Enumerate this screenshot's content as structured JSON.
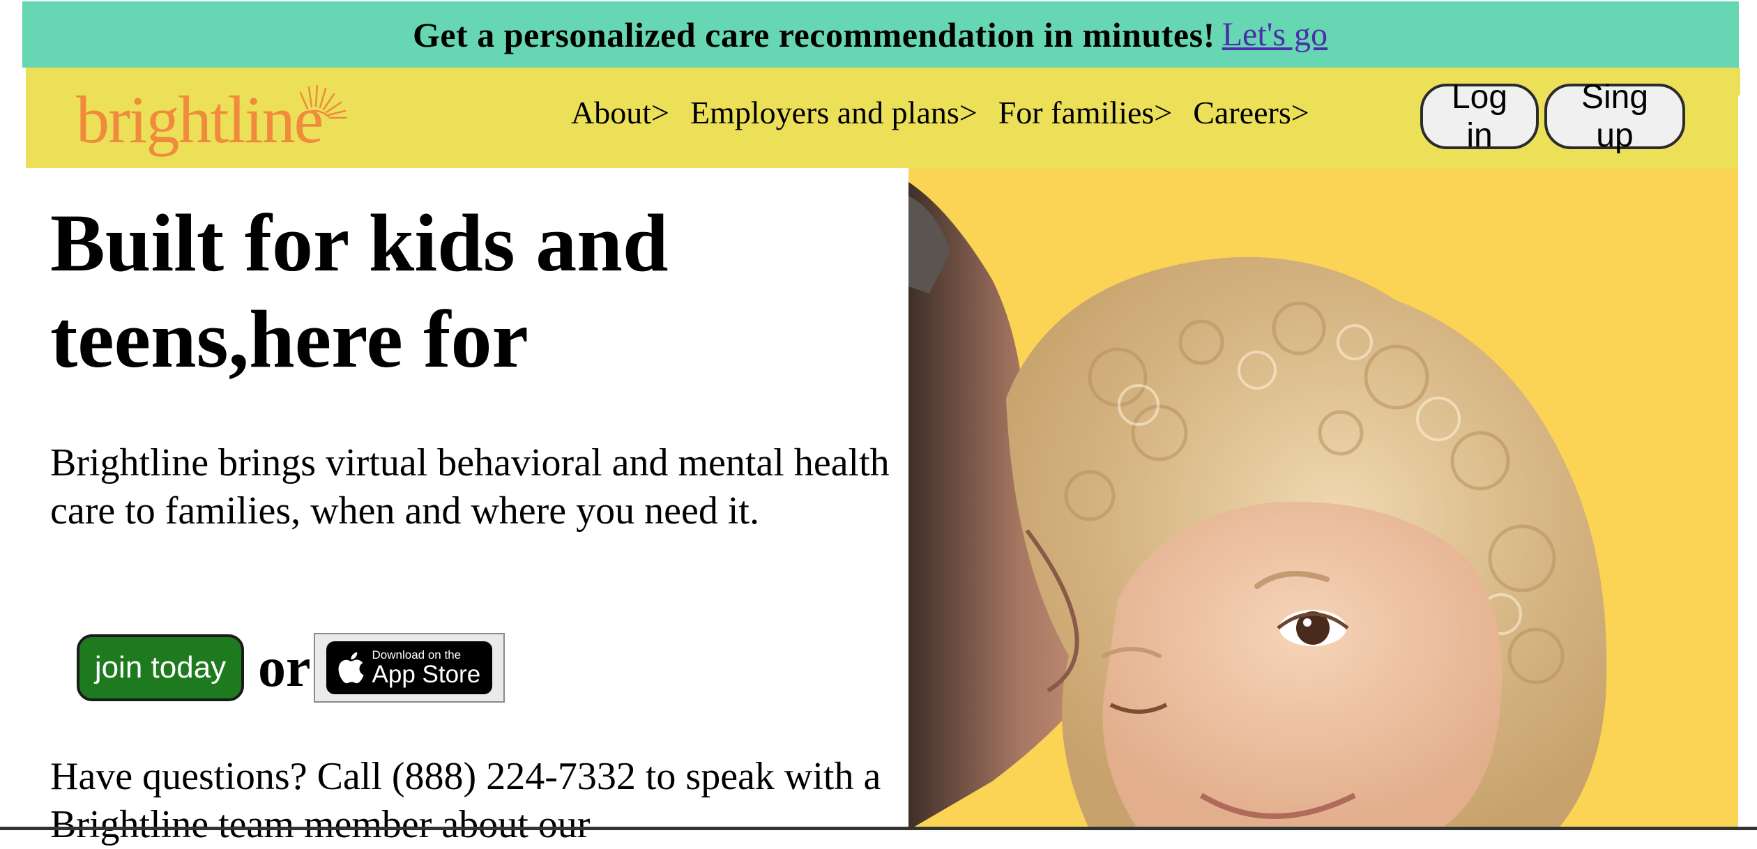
{
  "banner": {
    "text": "Get a personalized care recommendation in minutes!",
    "link_label": "Let's go"
  },
  "header": {
    "logo_text": "brightline",
    "nav": [
      {
        "label": "About>"
      },
      {
        "label": "Employers and plans>"
      },
      {
        "label": "For families>"
      },
      {
        "label": "Careers>"
      }
    ],
    "login_label": "Log in",
    "signup_label": "Sing up"
  },
  "hero": {
    "title": "Built for kids and teens,here for",
    "description": "Brightline brings virtual behavioral and mental health care to families, when and where you need it.",
    "join_label": "join today",
    "or_label": "or",
    "appstore_small": "Download on the",
    "appstore_big": "App Store",
    "questions": "Have questions? Call (888) 224-7332 to speak with a Brightline team member about our"
  },
  "colors": {
    "banner_bg": "#66d6b3",
    "header_bg": "#ece059",
    "logo": "#f08a3c",
    "hero_image_bg": "#fcd455",
    "join_button": "#1e7a1e",
    "link": "#4b2fa8"
  },
  "icons": {
    "logo_mark": "sun-rays-icon",
    "appstore": "apple-icon"
  }
}
